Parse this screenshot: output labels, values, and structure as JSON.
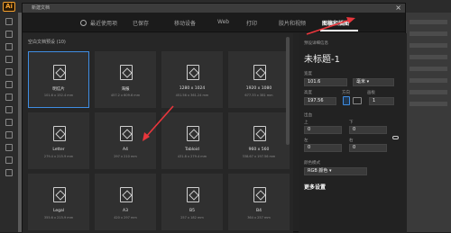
{
  "app": {
    "logo": "Ai"
  },
  "dialog": {
    "title": "新建文档",
    "close": "×",
    "tabs": [
      {
        "label": "最近使用项",
        "active": false
      },
      {
        "label": "已保存",
        "active": false
      },
      {
        "label": "移动设备",
        "active": false
      },
      {
        "label": "Web",
        "active": false
      },
      {
        "label": "打印",
        "active": false
      },
      {
        "label": "胶片和视频",
        "active": false
      },
      {
        "label": "图稿和插图",
        "active": true
      }
    ],
    "section_title": "空白文档预设 (10)",
    "presets": [
      {
        "name": "明信片",
        "size": "101.6 x 152.4 mm",
        "selected": true
      },
      {
        "name": "海报",
        "size": "457.2 x 609.6 mm",
        "selected": false
      },
      {
        "name": "1280 x 1024",
        "size": "451.56 x 361.24 mm",
        "selected": false
      },
      {
        "name": "1920 x 1080",
        "size": "677.33 x 381 mm",
        "selected": false
      },
      {
        "name": "Letter",
        "size": "279.4 x 215.9 mm",
        "selected": false
      },
      {
        "name": "A4",
        "size": "297 x 210 mm",
        "selected": false
      },
      {
        "name": "Tabloid",
        "size": "431.8 x 279.4 mm",
        "selected": false
      },
      {
        "name": "960 x 560",
        "size": "338.67 x 197.56 mm",
        "selected": false
      },
      {
        "name": "Legal",
        "size": "355.6 x 215.9 mm",
        "selected": false
      },
      {
        "name": "A3",
        "size": "420 x 297 mm",
        "selected": false
      },
      {
        "name": "B5",
        "size": "257 x 182 mm",
        "selected": false
      },
      {
        "name": "B4",
        "size": "364 x 257 mm",
        "selected": false
      }
    ],
    "details": {
      "header": "预设详细信息",
      "doc_name": "未标题-1",
      "width_label": "宽度",
      "width_value": "101.6",
      "unit": "毫米",
      "height_label": "高度",
      "height_value": "197.56",
      "orientation_label": "方向",
      "artboards_label": "画板",
      "artboards_value": "1",
      "bleed_label": "出血",
      "bleed_top_label": "上",
      "bleed_top": "0",
      "bleed_bottom_label": "下",
      "bleed_bottom": "0",
      "bleed_left_label": "左",
      "bleed_left": "0",
      "bleed_right_label": "右",
      "bleed_right": "0",
      "color_mode_label": "颜色模式",
      "color_mode_value": "RGB 颜色",
      "more_settings": "更多设置"
    }
  },
  "colors": {
    "accent": "#3f8de3",
    "arrow": "#e8363c",
    "tab_underline": "#ffffff"
  }
}
